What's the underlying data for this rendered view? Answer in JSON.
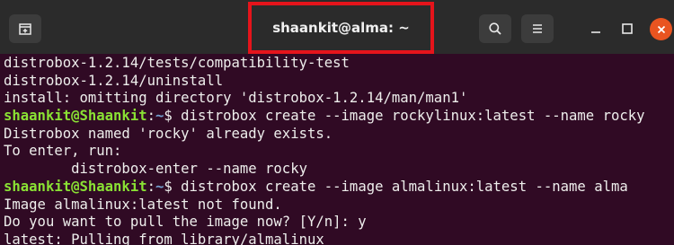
{
  "window": {
    "title": "shaankit@alma: ~",
    "accent_highlight": "#e5141b",
    "terminal_bg": "#300a24",
    "close_color": "#e95420"
  },
  "toolbar": {
    "new_tab_icon": "new-tab-icon",
    "search_icon": "search-icon",
    "menu_icon": "hamburger-menu-icon",
    "minimize_icon": "minimize-icon",
    "maximize_icon": "maximize-icon",
    "close_icon": "close-icon"
  },
  "terminal": {
    "lines": [
      {
        "text": "distrobox-1.2.14/tests/compatibility-test"
      },
      {
        "text": "distrobox-1.2.14/uninstall"
      },
      {
        "text": "install: omitting directory 'distrobox-1.2.14/man/man1'"
      },
      {
        "prompt_user": "shaankit@Shaankit",
        "prompt_sep": ":",
        "prompt_path": "~",
        "command": "$ distrobox create --image rockylinux:latest --name rocky"
      },
      {
        "text": "Distrobox named 'rocky' already exists."
      },
      {
        "text": "To enter, run:"
      },
      {
        "text": "        distrobox-enter --name rocky"
      },
      {
        "prompt_user": "shaankit@Shaankit",
        "prompt_sep": ":",
        "prompt_path": "~",
        "command": "$ distrobox create --image almalinux:latest --name alma"
      },
      {
        "text": "Image almalinux:latest not found."
      },
      {
        "text": "Do you want to pull the image now? [Y/n]: y"
      },
      {
        "text": "latest: Pulling from library/almalinux"
      }
    ]
  }
}
